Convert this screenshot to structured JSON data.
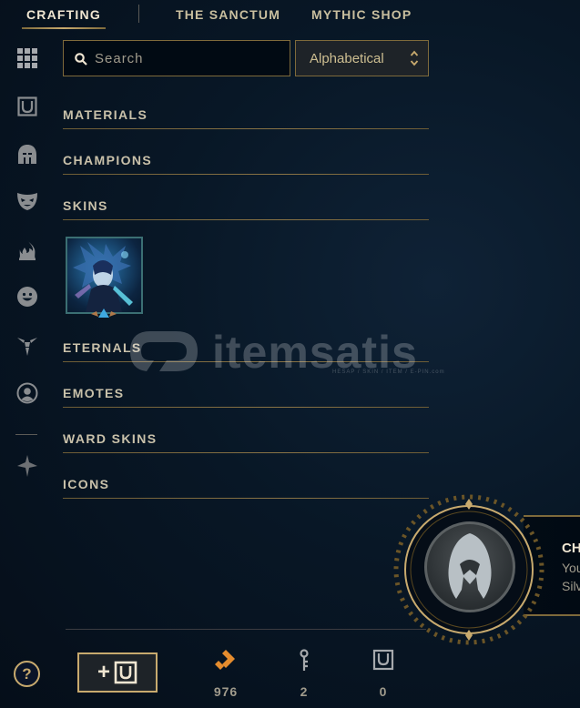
{
  "nav": {
    "tabs": [
      {
        "label": "CRAFTING",
        "active": true
      },
      {
        "label": "THE SANCTUM",
        "active": false
      },
      {
        "label": "MYTHIC SHOP",
        "active": false
      }
    ]
  },
  "sidebar": {
    "icons": [
      "grid-icon",
      "chest-icon",
      "helmet-icon",
      "mask-icon",
      "flame-icon",
      "smiley-icon",
      "ward-icon",
      "profile-icon",
      "champion-logo-icon"
    ]
  },
  "search": {
    "placeholder": "Search",
    "value": ""
  },
  "sort": {
    "selected": "Alphabetical"
  },
  "categories": {
    "materials": "MATERIALS",
    "champions": "CHAMPIONS",
    "skins": "SKINS",
    "eternals": "ETERNALS",
    "emotes": "EMOTES",
    "ward_skins": "WARD SKINS",
    "icons": "ICONS"
  },
  "watermark": {
    "text": "itemsatis",
    "subtext": "HESAP / SKIN / ITEM / E-PIN",
    "suffix": ".com"
  },
  "footer": {
    "help_label": "?",
    "add_label": "+",
    "currencies": [
      {
        "icon": "orange-essence-icon",
        "value": "976"
      },
      {
        "icon": "key-icon",
        "value": "2"
      },
      {
        "icon": "chest-icon",
        "value": "0"
      }
    ]
  },
  "notification": {
    "title": "CH",
    "line1": "You",
    "line2": "Silv"
  },
  "colors": {
    "gold": "#c8aa6e",
    "gold_dim": "#7e6a3b",
    "text_light": "#f0e6d2",
    "text_muted": "#a09b8c",
    "orange_essence": "#e58c2e",
    "background": "#081726"
  }
}
